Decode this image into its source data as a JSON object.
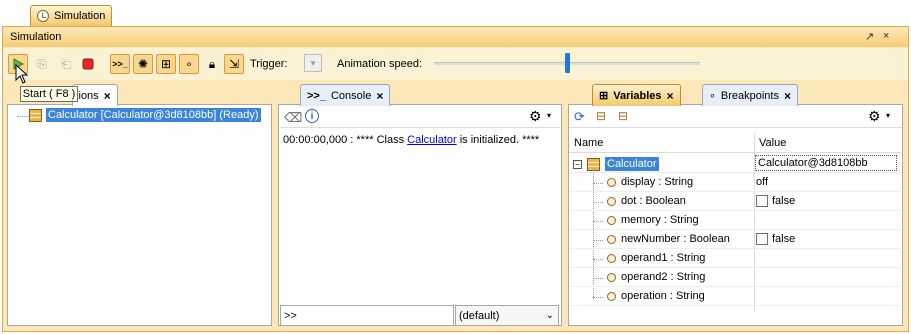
{
  "window": {
    "tab_label": "Simulation",
    "title": "Simulation",
    "controls": [
      "↗",
      "×"
    ]
  },
  "toolbar": {
    "trigger_label": "Trigger:",
    "animation_speed_label": "Animation speed:",
    "animation_speed": 0.5,
    "tooltip": "Start ( F8 )"
  },
  "sessions": {
    "tab_label_visible": "sions",
    "close": "×",
    "items": [
      {
        "label": "Calculator [Calculator@3d8108bb] (Ready)"
      }
    ]
  },
  "console": {
    "tab_label": "Console",
    "tab_prefix": ">>_",
    "close": "×",
    "log": {
      "prefix": "00:00:00,000 : **** Class ",
      "link": "Calculator",
      "suffix": " is initialized. ****"
    },
    "input_value": ">>",
    "combo_value": "(default)"
  },
  "variables": {
    "tab_label": "Variables",
    "breakpoints_tab_label": "Breakpoints",
    "close": "×",
    "columns": [
      "Name",
      "Value"
    ],
    "root": {
      "name": "Calculator",
      "value": "Calculator@3d8108bb"
    },
    "rows": [
      {
        "name": "display : String",
        "value": "off",
        "checkbox": false
      },
      {
        "name": "dot : Boolean",
        "value": "false",
        "checkbox": true
      },
      {
        "name": "memory : String",
        "value": "",
        "checkbox": false
      },
      {
        "name": "newNumber : Boolean",
        "value": "false",
        "checkbox": true
      },
      {
        "name": "operand1 : String",
        "value": "",
        "checkbox": false
      },
      {
        "name": "operand2 : String",
        "value": "",
        "checkbox": false
      },
      {
        "name": "operation : String",
        "value": "",
        "checkbox": false
      }
    ]
  },
  "colors": {
    "accent": "#f5c86e",
    "selection": "#3b83db",
    "slider": "#2377d6"
  }
}
